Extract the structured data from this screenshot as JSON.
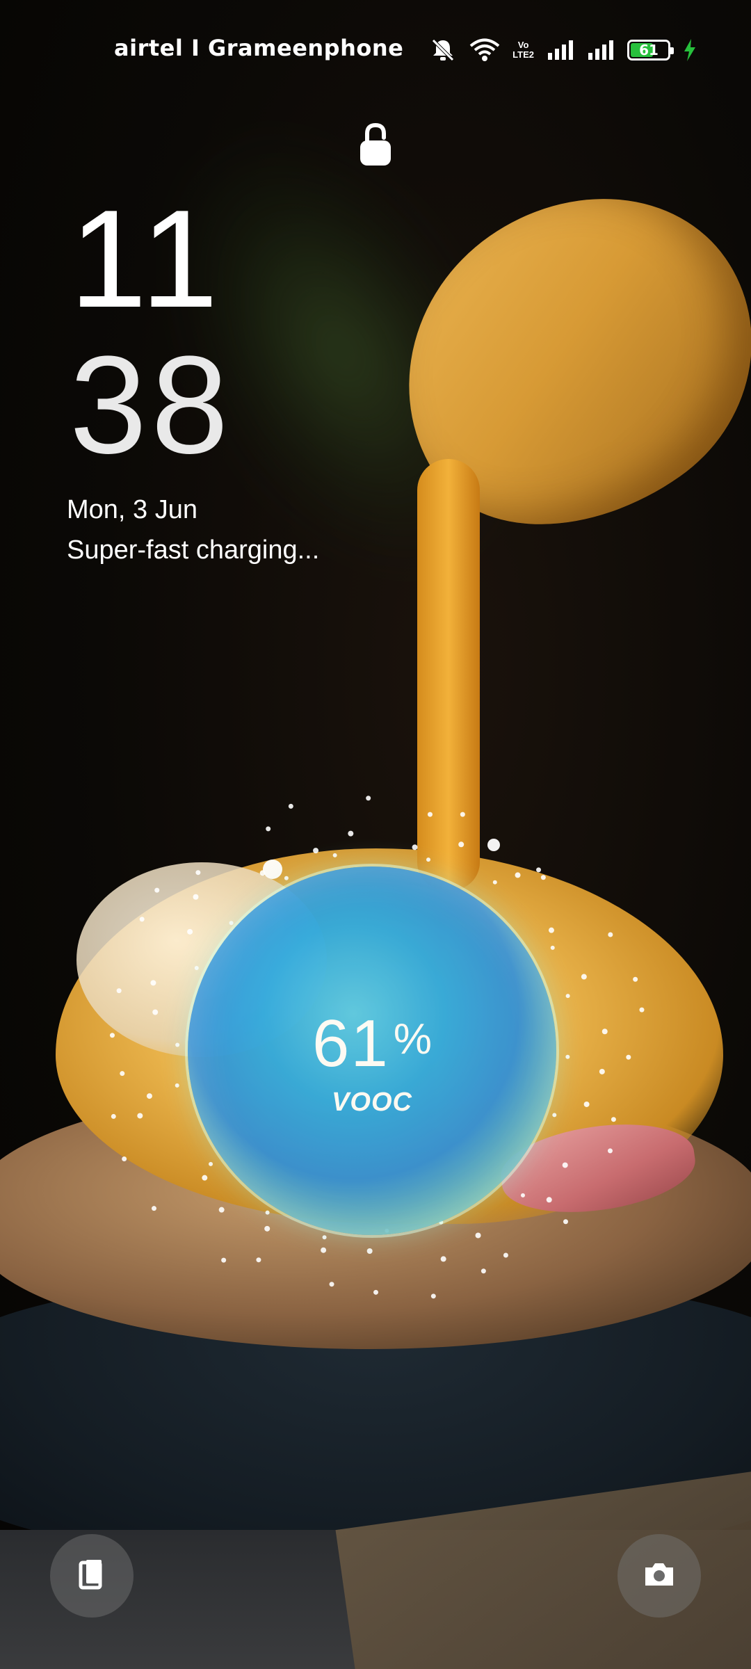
{
  "status_bar": {
    "carrier": "airtel I Grameenphone",
    "volte_label_top": "Vo",
    "volte_label_bottom": "LTE2",
    "battery_level": "61",
    "battery_color": "#27c03c",
    "icons": [
      "mute-icon",
      "wifi-icon",
      "volte-icon",
      "signal-icon",
      "signal-icon",
      "battery-icon",
      "charging-bolt-icon"
    ]
  },
  "lock": {
    "icon": "padlock-icon"
  },
  "clock": {
    "hours": "11",
    "minutes": "38",
    "date": "Mon, 3 Jun",
    "charging_status": "Super-fast charging..."
  },
  "charging": {
    "percent_value": "61",
    "percent_sign": "%",
    "brand": "VOOC",
    "level": 0.61
  },
  "shortcuts": {
    "left_icon": "wallet-icon",
    "right_icon": "camera-icon"
  }
}
